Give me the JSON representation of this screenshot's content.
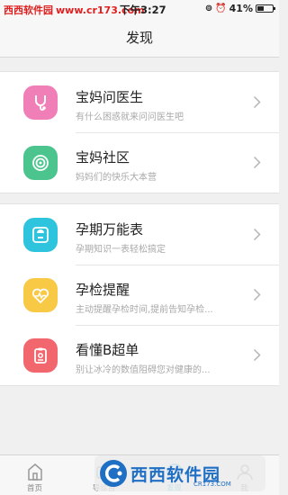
{
  "status_bar": {
    "watermark_cn": "西西软件园",
    "watermark_url": "www.cr173.com",
    "time": "下午3:27",
    "battery": "41%",
    "battery_level": 0.41
  },
  "nav": {
    "title": "发现"
  },
  "groups": [
    {
      "items": [
        {
          "title": "宝妈问医生",
          "subtitle": "有什么困惑就来问问医生吧",
          "icon": "stethoscope-icon",
          "color": "#f07eb7"
        },
        {
          "title": "宝妈社区",
          "subtitle": "妈妈们的快乐大本营",
          "icon": "community-icon",
          "color": "#4cc48e"
        }
      ]
    },
    {
      "items": [
        {
          "title": "孕期万能表",
          "subtitle": "孕期知识一表轻松搞定",
          "icon": "scale-icon",
          "color": "#2ec4dd"
        },
        {
          "title": "孕检提醒",
          "subtitle": "主动提醒孕检时间,提前告知孕检...",
          "icon": "heartbeat-icon",
          "color": "#f8c945"
        },
        {
          "title": "看懂B超单",
          "subtitle": "别让冰冷的数值阻碍您对健康的...",
          "icon": "report-icon",
          "color": "#f2666e"
        }
      ]
    }
  ],
  "tabs": [
    {
      "label": "首页",
      "icon": "home-icon"
    },
    {
      "label": "导诊台",
      "icon": "guide-desk-icon"
    },
    {
      "label": "发现",
      "icon": "discover-icon",
      "active": true
    },
    {
      "label": "我",
      "icon": "profile-icon"
    }
  ],
  "watermark": {
    "text": "西西软件园",
    "url": "CR173.COM"
  },
  "colors": {
    "accent": "#3bb8d8",
    "watermark_blue": "#1f6fc4"
  }
}
